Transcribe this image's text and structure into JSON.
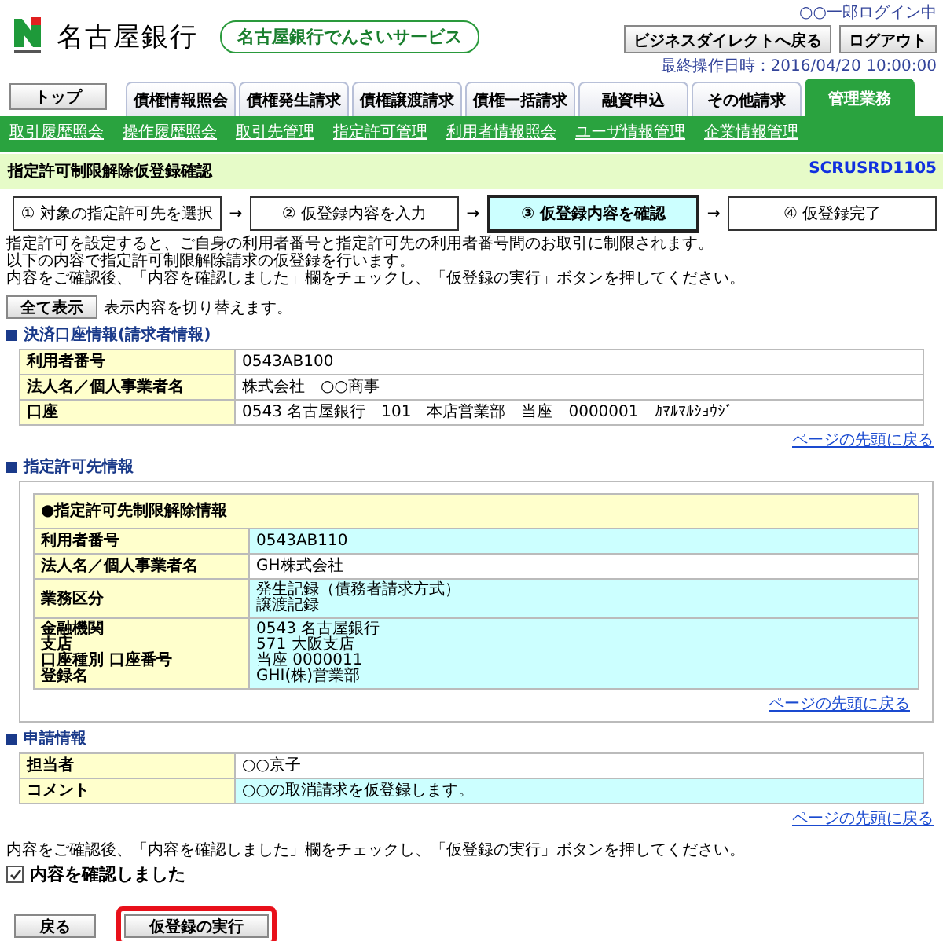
{
  "header": {
    "bank_name": "名古屋銀行",
    "service_name": "名古屋銀行でんさいサービス",
    "login_user": "○○一郎ログイン中",
    "buttons": [
      "ビジネスダイレクトへ戻る",
      "ログアウト"
    ],
    "last_operation": "最終操作日時：2016/04/20 10:00:00"
  },
  "top_button": "トップ",
  "tabs": [
    {
      "label": "債権情報照会",
      "selected": false
    },
    {
      "label": "債権発生請求",
      "selected": false
    },
    {
      "label": "債権譲渡請求",
      "selected": false
    },
    {
      "label": "債権一括請求",
      "selected": false
    },
    {
      "label": "融資申込",
      "selected": false
    },
    {
      "label": "その他請求",
      "selected": false
    },
    {
      "label": "管理業務",
      "selected": true
    }
  ],
  "submenu": [
    "取引履歴照会",
    "操作履歴照会",
    "取引先管理",
    "指定許可管理",
    "利用者情報照会",
    "ユーザ情報管理",
    "企業情報管理"
  ],
  "page_title": "指定許可制限解除仮登録確認",
  "screen_id": "SCRUSRD1105",
  "steps": [
    {
      "label": "① 対象の指定許可先を選択",
      "selected": false
    },
    {
      "label": "② 仮登録内容を入力",
      "selected": false
    },
    {
      "label": "③ 仮登録内容を確認",
      "selected": true
    },
    {
      "label": "④ 仮登録完了",
      "selected": false
    }
  ],
  "step_arrows": [
    "→",
    "→",
    "→"
  ],
  "description": [
    "指定許可を設定すると、ご自身の利用者番号と指定許可先の利用者番号間のお取引に制限されます。",
    "以下の内容で指定許可制限解除請求の仮登録を行います。",
    "内容をご確認後、「内容を確認しました」欄をチェックし、「仮登録の実行」ボタンを押してください。"
  ],
  "show_all_button": "全て表示",
  "show_all_note": "表示内容を切り替えます。",
  "sections": [
    {
      "heading": "決済口座情報(請求者情報)",
      "rows": [
        {
          "label": [
            "利用者番号"
          ],
          "value": [
            "0543AB100"
          ],
          "highlighted": false
        },
        {
          "label": [
            "法人名／個人事業者名"
          ],
          "value": [
            "株式会社　○○商事"
          ],
          "highlighted": false
        },
        {
          "label": [
            "口座"
          ],
          "value": [
            "0543 名古屋銀行　101　本店営業部　当座　0000001　ｶﾏﾙﾏﾙｼｮｳｼﾞ"
          ],
          "highlighted": false
        }
      ],
      "top_link": "ページの先頭に戻る"
    },
    {
      "heading": "指定許可先情報",
      "table_title": "●指定許可先制限解除情報",
      "rows": [
        {
          "label": [
            "利用者番号"
          ],
          "value": [
            "0543AB110"
          ],
          "highlighted": true
        },
        {
          "label": [
            "法人名／個人事業者名"
          ],
          "value": [
            "GH株式会社"
          ],
          "highlighted": false
        },
        {
          "label": [
            "業務区分"
          ],
          "value": [
            "発生記録（債務者請求方式）",
            "譲渡記録"
          ],
          "highlighted": true
        },
        {
          "label": [
            "金融機関",
            "支店",
            "口座種別 口座番号",
            "登録名"
          ],
          "value": [
            "0543 名古屋銀行",
            "571 大阪支店",
            "当座 0000011",
            "GHI(株)営業部"
          ],
          "highlighted": true
        }
      ],
      "top_link": "ページの先頭に戻る"
    },
    {
      "heading": "申請情報",
      "rows": [
        {
          "label": [
            "担当者"
          ],
          "value": [
            "○○京子"
          ],
          "highlighted": false
        },
        {
          "label": [
            "コメント"
          ],
          "value": [
            "○○の取消請求を仮登録します。"
          ],
          "highlighted": true
        }
      ],
      "top_link": "ページの先頭に戻る"
    }
  ],
  "confirm_note": "内容をご確認後、「内容を確認しました」欄をチェックし、「仮登録の実行」ボタンを押してください。",
  "confirm_checkbox": {
    "label": "内容を確認しました",
    "checked": true
  },
  "footer_buttons": [
    {
      "label": "戻る",
      "highlighted": false
    },
    {
      "label": "仮登録の実行",
      "highlighted": true
    }
  ]
}
